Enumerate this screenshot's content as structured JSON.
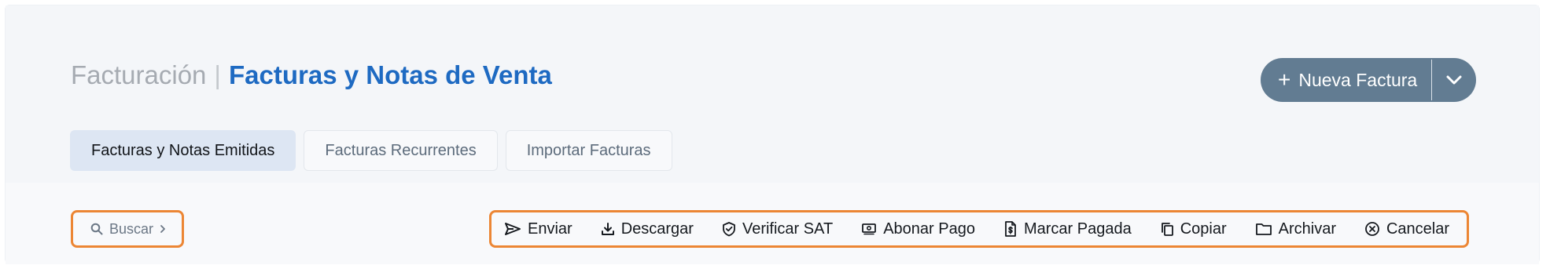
{
  "header": {
    "section": "Facturación",
    "separator": "|",
    "page_title": "Facturas y Notas de Venta"
  },
  "tabs": [
    {
      "label": "Facturas y Notas Emitidas",
      "active": true
    },
    {
      "label": "Facturas Recurrentes",
      "active": false
    },
    {
      "label": "Importar Facturas",
      "active": false
    }
  ],
  "new_button": {
    "label": "Nueva Factura",
    "icon": "plus-icon",
    "dropdown_icon": "chevron-down-icon"
  },
  "search": {
    "label": "Buscar",
    "icon": "search-icon",
    "chevron_icon": "chevron-right-icon"
  },
  "actions": [
    {
      "label": "Enviar",
      "icon": "send-icon"
    },
    {
      "label": "Descargar",
      "icon": "download-icon"
    },
    {
      "label": "Verificar SAT",
      "icon": "shield-check-icon"
    },
    {
      "label": "Abonar Pago",
      "icon": "payment-icon"
    },
    {
      "label": "Marcar Pagada",
      "icon": "document-dollar-icon"
    },
    {
      "label": "Copiar",
      "icon": "copy-icon"
    },
    {
      "label": "Archivar",
      "icon": "folder-icon"
    },
    {
      "label": "Cancelar",
      "icon": "cancel-circle-icon"
    }
  ],
  "colors": {
    "accent_blue": "#1e6ac2",
    "button_slate": "#627c92",
    "highlight_orange": "#ec8634",
    "active_tab_bg": "#dde6f3"
  }
}
